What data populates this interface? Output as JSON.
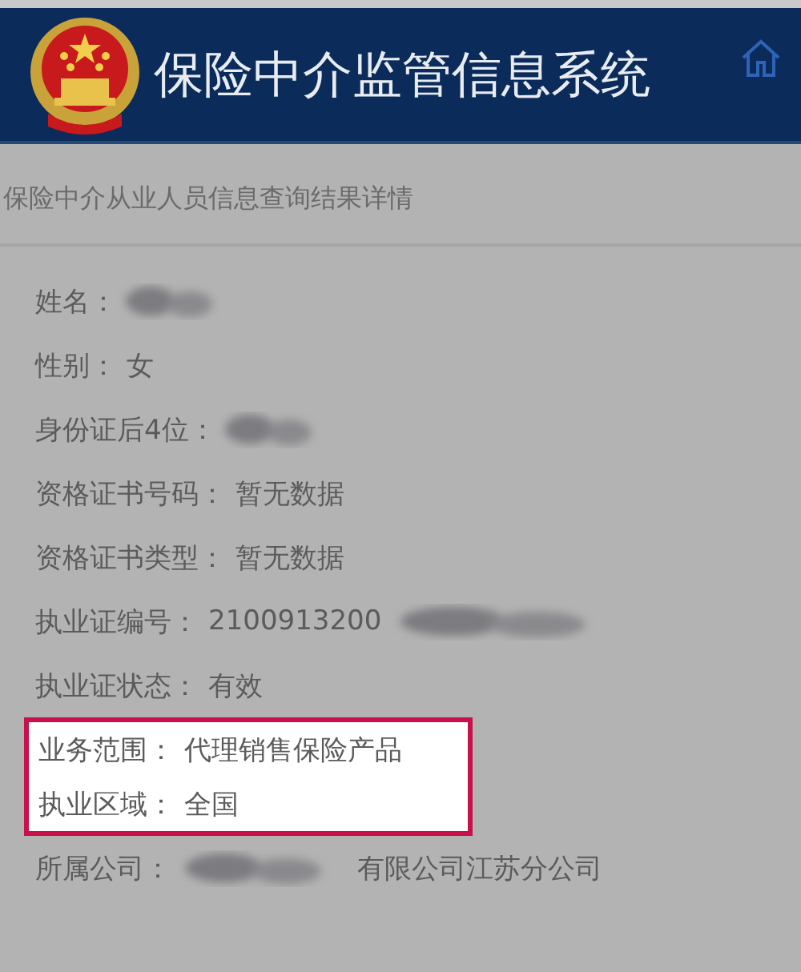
{
  "header": {
    "title": "保险中介监管信息系统"
  },
  "page_title": "保险中介从业人员信息查询结果详情",
  "fields": [
    {
      "label": "姓名：",
      "kind": "masked",
      "highlighted": false
    },
    {
      "label": "性别：",
      "value": "女",
      "kind": "plain",
      "highlighted": false
    },
    {
      "label": "身份证后4位：",
      "kind": "masked",
      "highlighted": false
    },
    {
      "label": "资格证书号码：",
      "value": "暂无数据",
      "kind": "plain",
      "highlighted": false
    },
    {
      "label": "资格证书类型：",
      "value": "暂无数据",
      "kind": "plain",
      "highlighted": false
    },
    {
      "label": "执业证编号：",
      "value": "2100913200",
      "kind": "tailmasked",
      "highlighted": false
    },
    {
      "label": "执业证状态：",
      "value": "有效",
      "kind": "plain",
      "highlighted": false
    },
    {
      "label": "业务范围：",
      "value": "代理销售保险产品",
      "kind": "plain",
      "highlighted": true
    },
    {
      "label": "执业区域：",
      "value": "全国",
      "kind": "plain",
      "highlighted": true
    },
    {
      "label": "所属公司：",
      "value": "有限公司江苏分公司",
      "kind": "headmasked",
      "highlighted": false
    }
  ]
}
